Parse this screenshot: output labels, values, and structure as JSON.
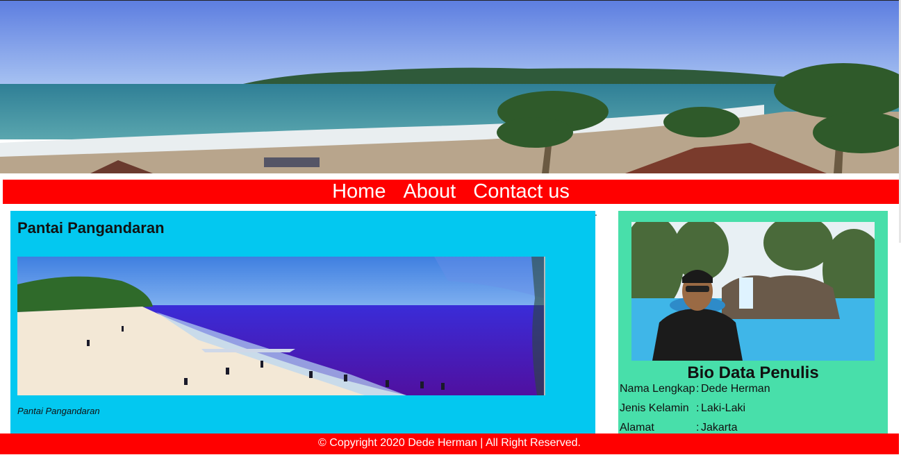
{
  "nav": {
    "home": "Home",
    "about": "About",
    "contact": "Contact us"
  },
  "stray_mark": ".",
  "article": {
    "title": "Pantai Pangandaran",
    "caption": "Pantai Pangandaran"
  },
  "sidebar": {
    "title": "Bio Data Penulis",
    "bio": [
      {
        "label": "Nama Lengkap",
        "sep": ":",
        "value": "Dede Herman"
      },
      {
        "label": "Jenis Kelamin",
        "sep": ":",
        "value": "Laki-Laki"
      },
      {
        "label": "Alamat",
        "sep": ":",
        "value": "Jakarta"
      }
    ]
  },
  "footer": {
    "text": "© Copyright 2020 Dede Herman | All Right Reserved."
  },
  "colors": {
    "nav": "#ff0000",
    "article_bg": "#03c8f0",
    "sidebar_bg": "#48dfaa",
    "footer": "#ff0000"
  }
}
